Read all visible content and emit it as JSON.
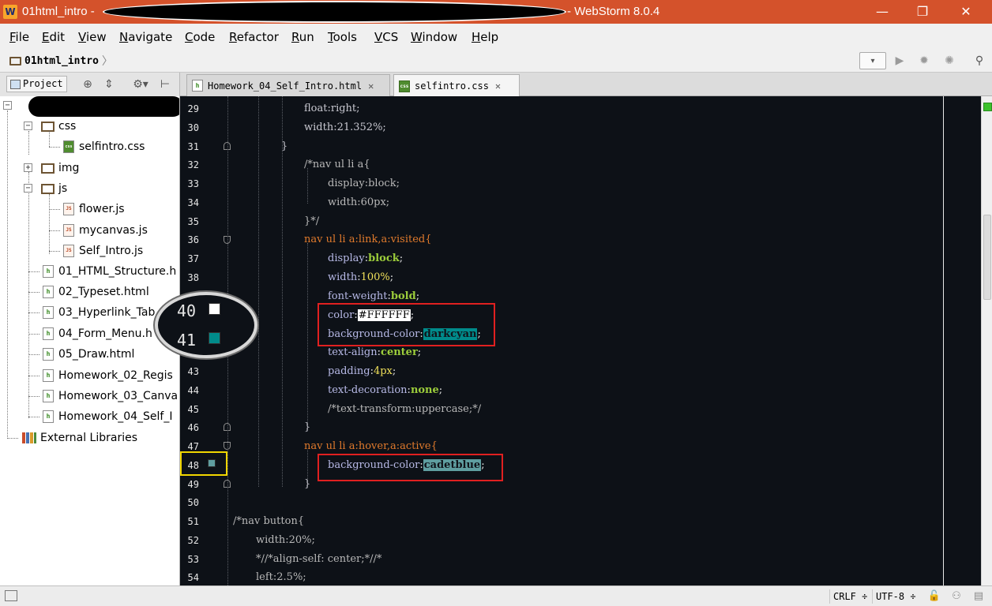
{
  "window": {
    "title_left": "01html_intro -",
    "title_right": "- WebStorm 8.0.4",
    "app_icon_glyph": "W",
    "controls": {
      "minimize": "—",
      "maximize": "❐",
      "close": "✕"
    }
  },
  "menu": [
    "File",
    "Edit",
    "View",
    "Navigate",
    "Code",
    "Refactor",
    "Run",
    "Tools",
    "VCS",
    "Window",
    "Help"
  ],
  "breadcrumb": {
    "project": "01html_intro",
    "separator": "〉"
  },
  "toolbar": {
    "run_config_glyph": "▾",
    "run": "▶",
    "debug": "✹",
    "coverage": "✺",
    "search": "⚲"
  },
  "project_panel": {
    "tab_label": "Project",
    "icons": [
      "⊕",
      "⇕",
      "⚙▾",
      "⊢"
    ],
    "tree": [
      {
        "label": "css",
        "type": "folder",
        "expanded": true
      },
      {
        "label": "selfintro.css",
        "type": "css"
      },
      {
        "label": "img",
        "type": "folder",
        "expanded": false
      },
      {
        "label": "js",
        "type": "folder",
        "expanded": true
      },
      {
        "label": "flower.js",
        "type": "js"
      },
      {
        "label": "mycanvas.js",
        "type": "js"
      },
      {
        "label": "Self_Intro.js",
        "type": "js"
      },
      {
        "label": "01_HTML_Structure.h",
        "type": "html"
      },
      {
        "label": "02_Typeset.html",
        "type": "html"
      },
      {
        "label": "03_Hyperlink_Tab",
        "type": "html"
      },
      {
        "label": "04_Form_Menu.h",
        "type": "html"
      },
      {
        "label": "05_Draw.html",
        "type": "html"
      },
      {
        "label": "Homework_02_Regis",
        "type": "html"
      },
      {
        "label": "Homework_03_Canva",
        "type": "html"
      },
      {
        "label": "Homework_04_Self_I",
        "type": "html"
      },
      {
        "label": "External Libraries",
        "type": "library"
      }
    ]
  },
  "editor_tabs": [
    {
      "label": "Homework_04_Self_Intro.html",
      "icon": "html-file-icon",
      "icon_text": "h",
      "active": false
    },
    {
      "label": "selfintro.css",
      "icon": "css-file-icon",
      "icon_text": "css",
      "active": true
    }
  ],
  "code_lines": [
    {
      "n": "29",
      "text": "float:right;"
    },
    {
      "n": "30",
      "text": "width:21.352%;"
    },
    {
      "n": "31",
      "text": "}"
    },
    {
      "n": "32",
      "text": "/*nav ul li a{"
    },
    {
      "n": "33",
      "text": "display:block;"
    },
    {
      "n": "34",
      "text": "width:60px;"
    },
    {
      "n": "35",
      "text": "}*/"
    },
    {
      "n": "36",
      "text": "nav ul li a:link,a:visited{"
    },
    {
      "n": "37",
      "text": "display:block;"
    },
    {
      "n": "38",
      "text": "width:100%;"
    },
    {
      "n": "39",
      "text": "font-weight:bold;"
    },
    {
      "n": "40",
      "text": "color:#FFFFFF;"
    },
    {
      "n": "41",
      "text": "background-color:darkcyan;"
    },
    {
      "n": "42",
      "text": "text-align:center;"
    },
    {
      "n": "43",
      "text": "padding:4px;"
    },
    {
      "n": "44",
      "text": "text-decoration:none;"
    },
    {
      "n": "45",
      "text": "/*text-transform:uppercase;*/"
    },
    {
      "n": "46",
      "text": "}"
    },
    {
      "n": "47",
      "text": "nav ul li a:hover,a:active{"
    },
    {
      "n": "48",
      "text": "background-color:cadetblue;"
    },
    {
      "n": "49",
      "text": "}"
    },
    {
      "n": "50",
      "text": ""
    },
    {
      "n": "51",
      "text": "/*nav button{"
    },
    {
      "n": "52",
      "text": "width:20%;"
    },
    {
      "n": "53",
      "text": "*//*align-self: center;*//*"
    },
    {
      "n": "54",
      "text": "left:2.5%;"
    }
  ],
  "magnifier": {
    "line_a": "40",
    "line_b": "41"
  },
  "colors": {
    "swatch_white": "#FFFFFF",
    "swatch_darkcyan": "#008B8B",
    "swatch_cadetblue": "#5F9EA0",
    "title_bar": "#D4522B"
  },
  "statusbar": {
    "line_separator": "CRLF ÷",
    "encoding": "UTF-8 ÷"
  }
}
